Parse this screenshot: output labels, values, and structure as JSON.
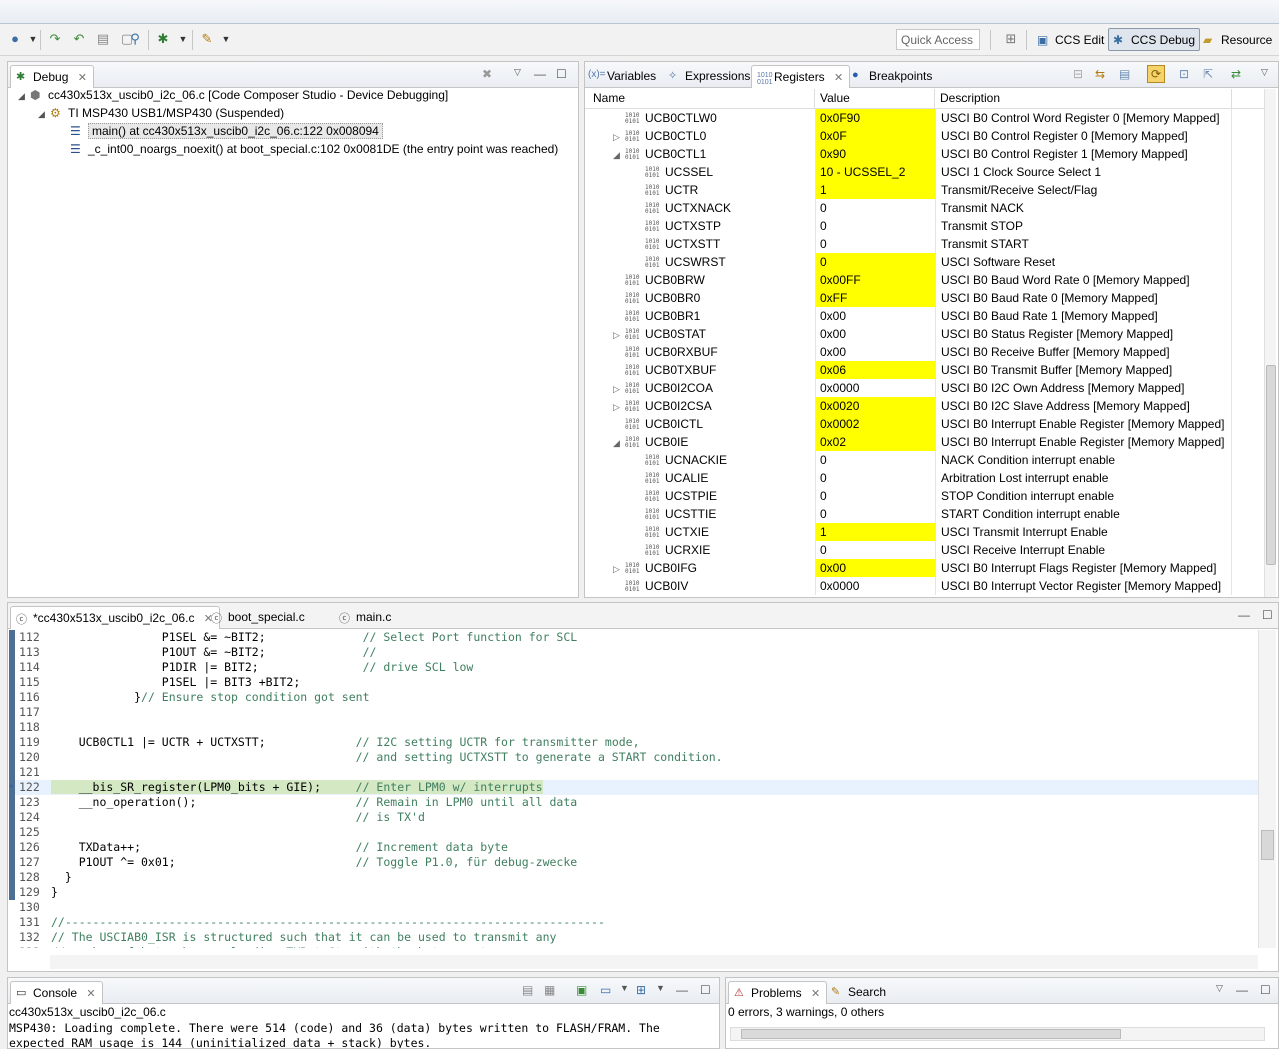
{
  "toolbar": {
    "quick_access_placeholder": "Quick Access",
    "perspectives": [
      {
        "label": "CCS Edit",
        "active": false
      },
      {
        "label": "CCS Debug",
        "active": true
      },
      {
        "label": "Resource",
        "active": false
      }
    ]
  },
  "debug_view": {
    "tab_label": "Debug",
    "tree": [
      {
        "level": 0,
        "expander": "◢",
        "icon": "debug-session-icon",
        "text": "cc430x513x_uscib0_i2c_06.c [Code Composer Studio - Device Debugging]"
      },
      {
        "level": 1,
        "expander": "◢",
        "icon": "thread-icon",
        "text": "TI MSP430 USB1/MSP430 (Suspended)"
      },
      {
        "level": 2,
        "expander": "",
        "icon": "stack-frame-icon",
        "text": "main() at cc430x513x_uscib0_i2c_06.c:122 0x008094",
        "selected": true
      },
      {
        "level": 2,
        "expander": "",
        "icon": "stack-frame-icon",
        "text": "_c_int00_noargs_noexit() at boot_special.c:102 0x0081DE  (the entry point was reached)"
      }
    ]
  },
  "registers_view": {
    "tabs": [
      "Variables",
      "Expressions",
      "Registers",
      "Breakpoints"
    ],
    "tab_icons": [
      "(x)=",
      "",
      "",
      ""
    ],
    "columns": [
      "Name",
      "Value",
      "Description"
    ],
    "rows": [
      {
        "indent": 0,
        "exp": "",
        "name": "UCB0CTLW0",
        "value": "0x0F90",
        "changed": true,
        "desc": "USCI B0 Control Word Register 0 [Memory Mapped]"
      },
      {
        "indent": 0,
        "exp": "▷",
        "name": "UCB0CTL0",
        "value": "0x0F",
        "changed": true,
        "desc": "USCI B0 Control Register 0 [Memory Mapped]"
      },
      {
        "indent": 0,
        "exp": "◢",
        "name": "UCB0CTL1",
        "value": "0x90",
        "changed": true,
        "desc": "USCI B0 Control Register 1 [Memory Mapped]"
      },
      {
        "indent": 1,
        "exp": "",
        "name": "UCSSEL",
        "value": "10 - UCSSEL_2",
        "changed": true,
        "desc": "USCI 1 Clock Source Select 1"
      },
      {
        "indent": 1,
        "exp": "",
        "name": "UCTR",
        "value": "1",
        "changed": true,
        "desc": "Transmit/Receive Select/Flag"
      },
      {
        "indent": 1,
        "exp": "",
        "name": "UCTXNACK",
        "value": "0",
        "changed": false,
        "desc": "Transmit NACK"
      },
      {
        "indent": 1,
        "exp": "",
        "name": "UCTXSTP",
        "value": "0",
        "changed": false,
        "desc": "Transmit STOP"
      },
      {
        "indent": 1,
        "exp": "",
        "name": "UCTXSTT",
        "value": "0",
        "changed": false,
        "desc": "Transmit START"
      },
      {
        "indent": 1,
        "exp": "",
        "name": "UCSWRST",
        "value": "0",
        "changed": true,
        "desc": "USCI Software Reset"
      },
      {
        "indent": 0,
        "exp": "",
        "name": "UCB0BRW",
        "value": "0x00FF",
        "changed": true,
        "desc": "USCI B0 Baud Word Rate 0 [Memory Mapped]"
      },
      {
        "indent": 0,
        "exp": "",
        "name": "UCB0BR0",
        "value": "0xFF",
        "changed": true,
        "desc": "USCI B0 Baud Rate 0 [Memory Mapped]"
      },
      {
        "indent": 0,
        "exp": "",
        "name": "UCB0BR1",
        "value": "0x00",
        "changed": false,
        "desc": "USCI B0 Baud Rate 1 [Memory Mapped]"
      },
      {
        "indent": 0,
        "exp": "▷",
        "name": "UCB0STAT",
        "value": "0x00",
        "changed": false,
        "desc": "USCI B0 Status Register [Memory Mapped]"
      },
      {
        "indent": 0,
        "exp": "",
        "name": "UCB0RXBUF",
        "value": "0x00",
        "changed": false,
        "desc": "USCI B0 Receive Buffer [Memory Mapped]"
      },
      {
        "indent": 0,
        "exp": "",
        "name": "UCB0TXBUF",
        "value": "0x06",
        "changed": true,
        "desc": "USCI B0 Transmit Buffer [Memory Mapped]"
      },
      {
        "indent": 0,
        "exp": "▷",
        "name": "UCB0I2COA",
        "value": "0x0000",
        "changed": false,
        "desc": "USCI B0 I2C Own Address [Memory Mapped]"
      },
      {
        "indent": 0,
        "exp": "▷",
        "name": "UCB0I2CSA",
        "value": "0x0020",
        "changed": true,
        "desc": "USCI B0 I2C Slave Address [Memory Mapped]"
      },
      {
        "indent": 0,
        "exp": "",
        "name": "UCB0ICTL",
        "value": "0x0002",
        "changed": true,
        "desc": "USCI B0 Interrupt Enable Register [Memory Mapped]"
      },
      {
        "indent": 0,
        "exp": "◢",
        "name": "UCB0IE",
        "value": "0x02",
        "changed": true,
        "desc": "USCI B0 Interrupt Enable Register [Memory Mapped]"
      },
      {
        "indent": 1,
        "exp": "",
        "name": "UCNACKIE",
        "value": "0",
        "changed": false,
        "desc": "NACK Condition interrupt enable"
      },
      {
        "indent": 1,
        "exp": "",
        "name": "UCALIE",
        "value": "0",
        "changed": false,
        "desc": "Arbitration Lost interrupt enable"
      },
      {
        "indent": 1,
        "exp": "",
        "name": "UCSTPIE",
        "value": "0",
        "changed": false,
        "desc": "STOP Condition interrupt enable"
      },
      {
        "indent": 1,
        "exp": "",
        "name": "UCSTTIE",
        "value": "0",
        "changed": false,
        "desc": "START Condition interrupt enable"
      },
      {
        "indent": 1,
        "exp": "",
        "name": "UCTXIE",
        "value": "1",
        "changed": true,
        "desc": "USCI Transmit Interrupt Enable"
      },
      {
        "indent": 1,
        "exp": "",
        "name": "UCRXIE",
        "value": "0",
        "changed": false,
        "desc": "USCI Receive Interrupt Enable"
      },
      {
        "indent": 0,
        "exp": "▷",
        "name": "UCB0IFG",
        "value": "0x00",
        "changed": true,
        "desc": "USCI B0 Interrupt Flags Register [Memory Mapped]"
      },
      {
        "indent": 0,
        "exp": "",
        "name": "UCB0IV",
        "value": "0x0000",
        "changed": false,
        "desc": "USCI B0 Interrupt Vector Register [Memory Mapped]"
      }
    ]
  },
  "editor": {
    "tabs": [
      "*cc430x513x_uscib0_i2c_06.c",
      "boot_special.c",
      "main.c"
    ],
    "lines": [
      {
        "n": "112",
        "code": "                P1SEL &= ~BIT2;",
        "comment": "              // Select Port function for SCL"
      },
      {
        "n": "113",
        "code": "                P1OUT &= ~BIT2;",
        "comment": "              //"
      },
      {
        "n": "114",
        "code": "                P1DIR |= BIT2;",
        "comment": "               // drive SCL low"
      },
      {
        "n": "115",
        "code": "                P1SEL |= BIT3 +BIT2;",
        "comment": ""
      },
      {
        "n": "116",
        "code": "            }",
        "comment": "// Ensure stop condition got sent"
      },
      {
        "n": "117",
        "code": "",
        "comment": ""
      },
      {
        "n": "118",
        "code": "",
        "comment": ""
      },
      {
        "n": "119",
        "code": "    UCB0CTL1 |= UCTR + UCTXSTT;",
        "comment": "             // I2C setting UCTR for transmitter mode,"
      },
      {
        "n": "120",
        "code": "",
        "comment": "                                            // and setting UCTXSTT to generate a START condition."
      },
      {
        "n": "121",
        "code": "",
        "comment": ""
      },
      {
        "n": "122",
        "code": "    __bis_SR_register(LPM0_bits + GIE);",
        "comment": "     // Enter LPM0 w/ interrupts",
        "current": true
      },
      {
        "n": "123",
        "code": "    __no_operation();",
        "comment": "                       // Remain in LPM0 until all data"
      },
      {
        "n": "124",
        "code": "",
        "comment": "                                            // is TX'd"
      },
      {
        "n": "125",
        "code": "",
        "comment": ""
      },
      {
        "n": "126",
        "code": "    TXData++;",
        "comment": "                               // Increment data byte"
      },
      {
        "n": "127",
        "code": "    P1OUT ^= 0x01;",
        "comment": "                          // Toggle P1.0, für debug-zwecke"
      },
      {
        "n": "128",
        "code": "  }",
        "comment": ""
      },
      {
        "n": "129",
        "code": "}",
        "comment": ""
      },
      {
        "n": "130",
        "code": "",
        "comment": ""
      },
      {
        "n": "131",
        "code": "",
        "comment": "//------------------------------------------------------------------------------"
      },
      {
        "n": "132",
        "code": "",
        "comment": "// The USCIAB0_ISR is structured such that it can be used to transmit any"
      },
      {
        "n": "133",
        "code": "",
        "comment": "// number of bytes by pre-loading TXByteCtr with the byte count."
      }
    ]
  },
  "console": {
    "tab_label": "Console",
    "title": "cc430x513x_uscib0_i2c_06.c",
    "lines": [
      "MSP430: Loading complete. There were 514 (code) and 36 (data) bytes written to FLASH/FRAM. The",
      "expected RAM usage is 144 (uninitialized data + stack) bytes."
    ]
  },
  "problems": {
    "tab_label": "Problems",
    "search_label": "Search",
    "summary": "0 errors, 3 warnings, 0 others"
  }
}
